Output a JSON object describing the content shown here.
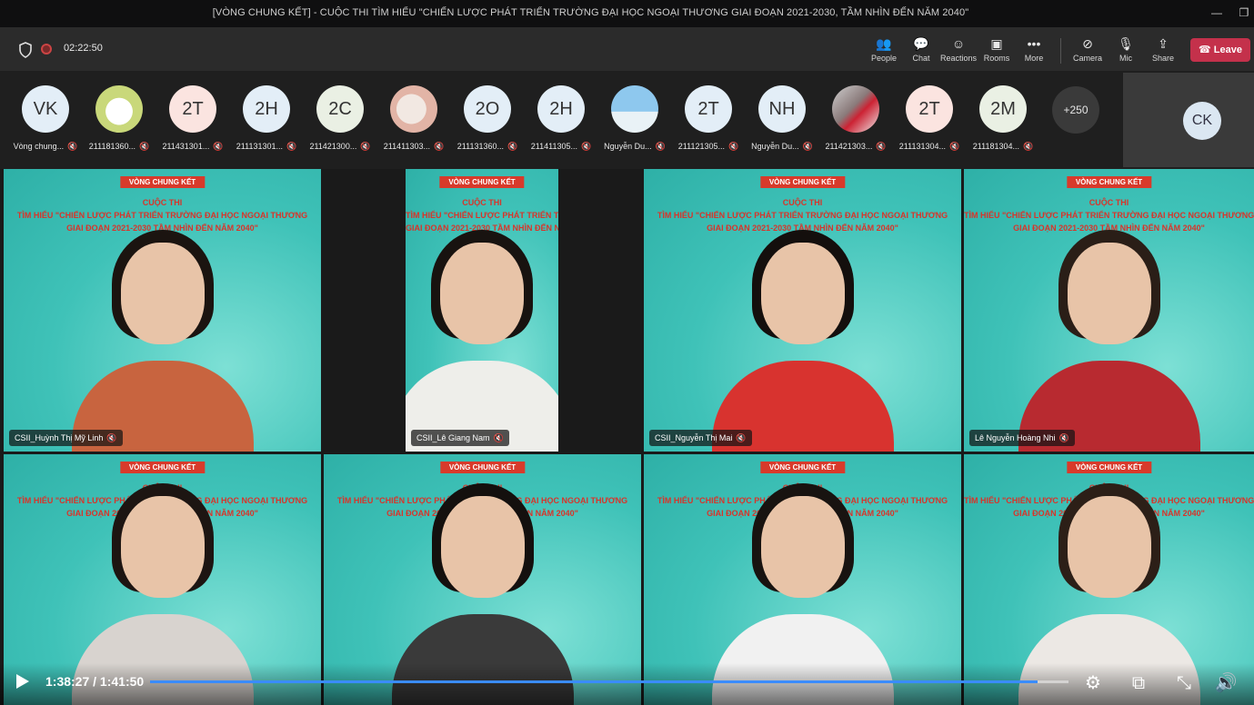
{
  "window": {
    "title": "[VÒNG CHUNG KẾT] - CUỘC THI TÌM HIỂU \"CHIẾN LƯỢC PHÁT TRIỂN TRƯỜNG ĐẠI HỌC NGOẠI THƯƠNG GIAI ĐOẠN 2021-2030, TẦM NHÌN ĐẾN NĂM 2040\"",
    "min_glyph": "—",
    "max_glyph": "❐"
  },
  "toolbar": {
    "timer": "02:22:50",
    "buttons": [
      {
        "label": "People",
        "icon": "people-icon",
        "glyph": "👥"
      },
      {
        "label": "Chat",
        "icon": "chat-icon",
        "glyph": "💬"
      },
      {
        "label": "Reactions",
        "icon": "reactions-icon",
        "glyph": "☺"
      },
      {
        "label": "Rooms",
        "icon": "rooms-icon",
        "glyph": "▣"
      },
      {
        "label": "More",
        "icon": "more-icon",
        "glyph": "•••"
      },
      {
        "label": "Camera",
        "icon": "camera-off-icon",
        "glyph": "⊘"
      },
      {
        "label": "Mic",
        "icon": "mic-off-icon",
        "glyph": "🎙"
      },
      {
        "label": "Share",
        "icon": "share-icon",
        "glyph": "⇪"
      }
    ],
    "leave_label": "Leave",
    "leave_glyph": "☎"
  },
  "participants": [
    {
      "initials": "VK",
      "name": "Vòng chung...",
      "style": "blue"
    },
    {
      "initials": "",
      "name": "211181360...",
      "style": "img1"
    },
    {
      "initials": "2T",
      "name": "211431301...",
      "style": "pink"
    },
    {
      "initials": "2H",
      "name": "211131301...",
      "style": "blue"
    },
    {
      "initials": "2C",
      "name": "211421300...",
      "style": "green"
    },
    {
      "initials": "",
      "name": "211411303...",
      "style": "img2"
    },
    {
      "initials": "2O",
      "name": "211131360...",
      "style": "blue"
    },
    {
      "initials": "2H",
      "name": "211411305...",
      "style": "blue"
    },
    {
      "initials": "",
      "name": "Nguyễn Du...",
      "style": "img3"
    },
    {
      "initials": "2T",
      "name": "211121305...",
      "style": "blue"
    },
    {
      "initials": "NH",
      "name": "Nguyễn Du...",
      "style": "blue"
    },
    {
      "initials": "",
      "name": "211421303...",
      "style": "img4"
    },
    {
      "initials": "2T",
      "name": "211131304...",
      "style": "pink"
    },
    {
      "initials": "2M",
      "name": "211181304...",
      "style": "green"
    }
  ],
  "more_participants": "+250",
  "self_initials": "CK",
  "video_tiles": [
    {
      "name": "CSII_Huỳnh Thị Mỹ Linh",
      "shirt": "#c8643f",
      "hair": "#1b1410",
      "active": false
    },
    {
      "name": "CSII_Lê Giang Nam",
      "shirt": "#eeeeea",
      "hair": "#181310",
      "active": false
    },
    {
      "name": "CSII_Nguyễn Thị Mai",
      "shirt": "#d8332f",
      "hair": "#140f0d",
      "active": false
    },
    {
      "name": "Lê Nguyễn Hoàng Nhi",
      "shirt": "#b82a30",
      "hair": "#2a1e17",
      "active": false
    },
    {
      "name": "",
      "shirt": "#d8d3cf",
      "hair": "#1d1512",
      "active": true
    },
    {
      "name": "",
      "shirt": "#3a3a3a",
      "hair": "#14100e",
      "active": false
    },
    {
      "name": "",
      "shirt": "#f1f1f1",
      "hair": "#181310",
      "active": false
    },
    {
      "name": "",
      "shirt": "#ece8e4",
      "hair": "#2c1f17",
      "active": false
    }
  ],
  "slide": {
    "banner": "VÒNG CHUNG KẾT",
    "line1": "CUỘC THI",
    "line2": "TÌM HIỂU \"CHIẾN LƯỢC PHÁT TRIỂN TRƯỜNG ĐẠI HỌC NGOẠI THƯƠNG",
    "line3": "GIAI ĐOẠN 2021-2030 TẦM NHÌN ĐẾN NĂM 2040\""
  },
  "player": {
    "time": "1:38:27 / 1:41:50",
    "progress": 0.9667,
    "settings_glyph": "⚙",
    "miniplayer_glyph": "⧉",
    "fullscreen_glyph": "⤡",
    "volume_glyph": "🔊"
  },
  "mic_off_glyph": "🔇"
}
